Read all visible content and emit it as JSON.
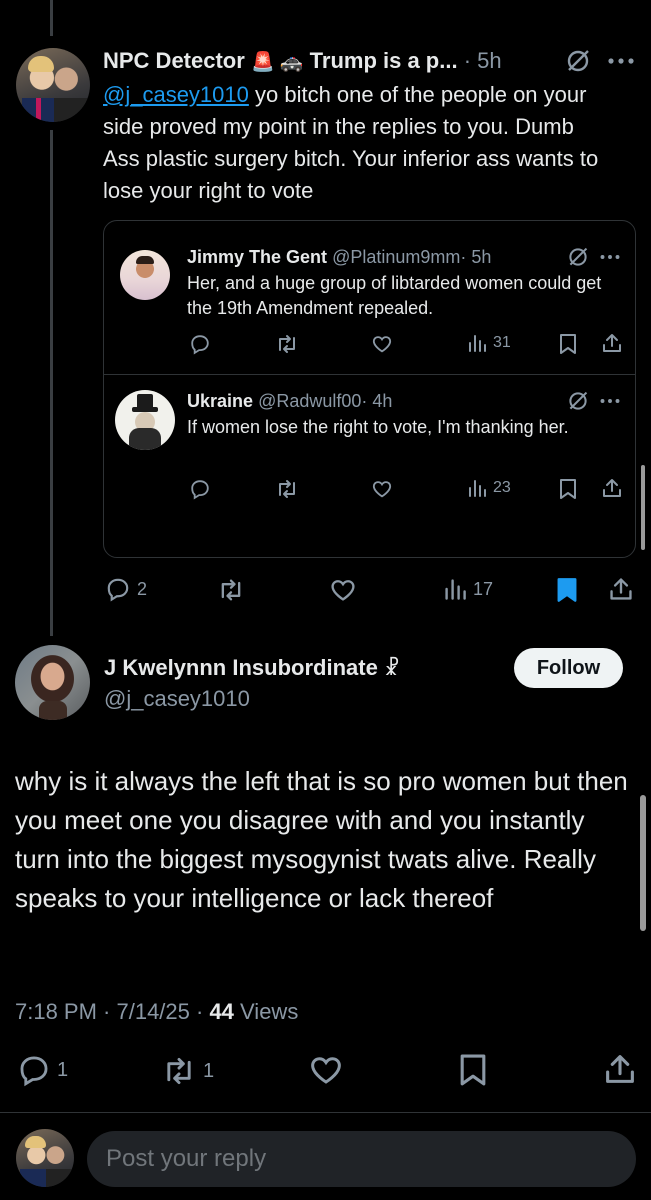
{
  "parent_post": {
    "author_name": "NPC Detector",
    "author_badges": "🚨 🚓",
    "author_name_suffix": "Trump is a p...",
    "time": "· 5h",
    "mention": "@j_casey1010",
    "text_after_mention": " yo bitch one of the people on your side proved my point in the replies to you. Dumb Ass plastic surgery bitch. Your inferior ass wants to lose your right to vote",
    "actions": {
      "replies": "2",
      "reposts": "",
      "likes": "",
      "views": "17"
    }
  },
  "quoted_1": {
    "author_name": "Jimmy The Gent",
    "handle": "@Platinum9mm",
    "time": "· 5h",
    "text": "Her, and a huge group of libtarded women could get the 19th Amendment repealed.",
    "views": "31"
  },
  "quoted_2": {
    "author_name": "Ukraine",
    "handle": "@Radwulf00",
    "time": "· 4h",
    "text": "If women lose the right to vote, I'm thanking her.",
    "views": "23"
  },
  "main_post": {
    "author_name": "J Kwelynnn Insubordinate",
    "author_symbol": "☧",
    "handle": "@j_casey1010",
    "follow_label": "Follow",
    "text": "why is it always the left that is so pro women but then you meet one you disagree with and you instantly turn into the biggest mysogynist twats alive. Really speaks to your intelligence or lack thereof",
    "meta_time": "7:18 PM · 7/14/25 · ",
    "meta_views_count": "44",
    "meta_views_label": " Views",
    "actions": {
      "replies": "1",
      "reposts": "1",
      "likes": ""
    }
  },
  "reply_bar": {
    "placeholder": "Post your reply"
  },
  "colors": {
    "background": "#000000",
    "text": "#e7e9ea",
    "muted": "#8b98a5",
    "accent": "#1d9bf0",
    "border": "#2f3336"
  },
  "icons": [
    "grok-icon",
    "more-icon",
    "reply-icon",
    "repost-icon",
    "like-icon",
    "views-icon",
    "bookmark-icon",
    "share-icon"
  ]
}
